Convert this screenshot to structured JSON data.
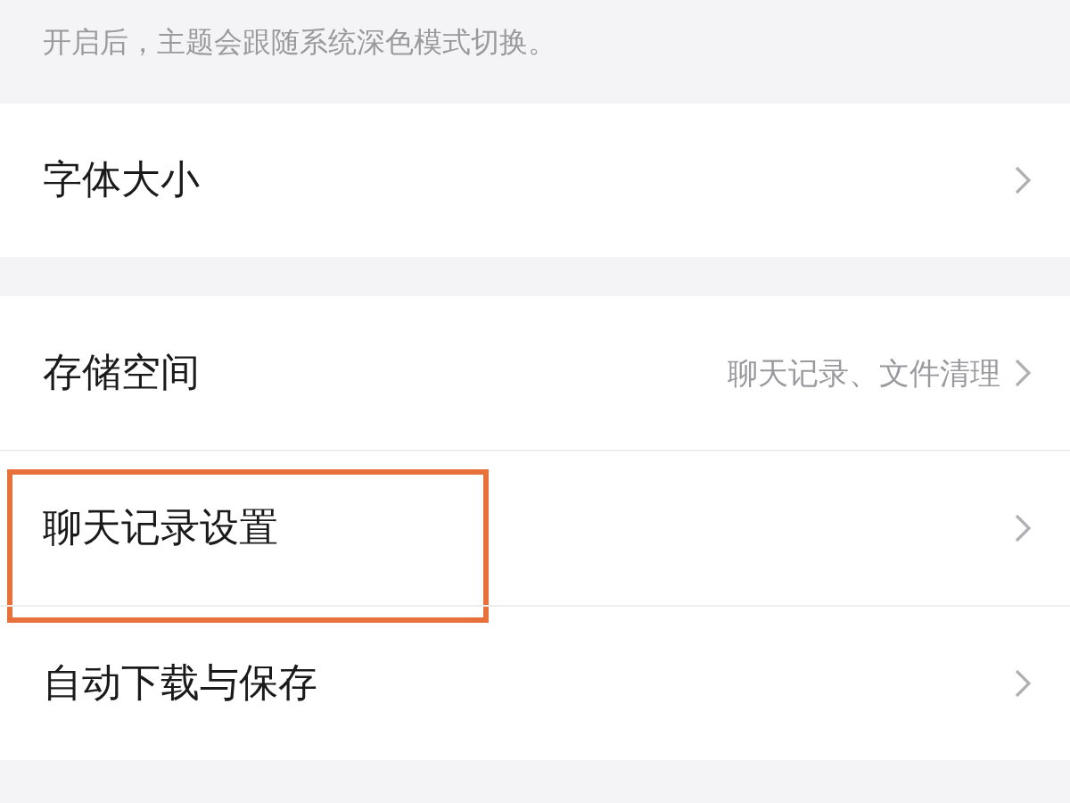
{
  "hint": "开启后，主题会跟随系统深色模式切换。",
  "groups": [
    {
      "items": [
        {
          "label": "字体大小",
          "highlighted": false
        }
      ]
    },
    {
      "items": [
        {
          "label": "存储空间",
          "value": "聊天记录、文件清理",
          "highlighted": false
        },
        {
          "label": "聊天记录设置",
          "highlighted": true
        },
        {
          "label": "自动下载与保存",
          "highlighted": false
        }
      ]
    }
  ]
}
